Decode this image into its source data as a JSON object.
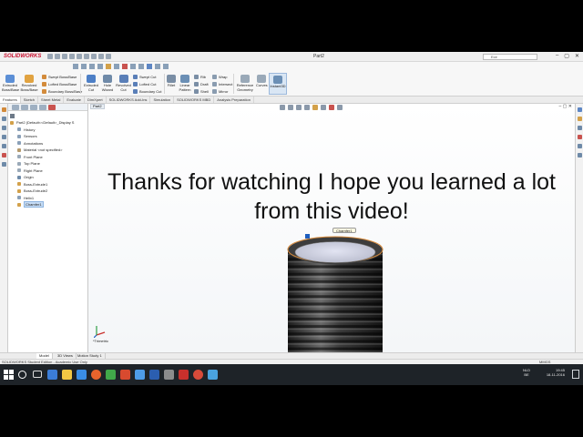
{
  "app": {
    "logo": "SOLIDWORKS",
    "document_title": "Part2",
    "search_placeholder": "Ece",
    "window_controls": [
      "–",
      "▢",
      "✕"
    ]
  },
  "ribbon": {
    "large_buttons": [
      {
        "label": "Extruded Boss/Base",
        "icon": "extruded-boss-icon"
      },
      {
        "label": "Revolved Boss/Base",
        "icon": "revolved-boss-icon"
      },
      {
        "label": "Extruded Cut",
        "icon": "extruded-cut-icon"
      },
      {
        "label": "Hole Wizard",
        "icon": "hole-wizard-icon"
      },
      {
        "label": "Revolved Cut",
        "icon": "revolved-cut-icon"
      },
      {
        "label": "Fillet",
        "icon": "fillet-icon"
      },
      {
        "label": "Linear Pattern",
        "icon": "linear-pattern-icon"
      },
      {
        "label": "Reference Geometry",
        "icon": "reference-geometry-icon"
      },
      {
        "label": "Curves",
        "icon": "curves-icon"
      },
      {
        "label": "Instant3D",
        "icon": "instant3d-icon"
      }
    ],
    "small_buttons": [
      "Swept Boss/Base",
      "Lofted Boss/Base",
      "Boundary Boss/Base",
      "Swept Cut",
      "Lofted Cut",
      "Boundary Cut",
      "Rib",
      "Draft",
      "Shell",
      "Wrap",
      "Intersect",
      "Mirror"
    ]
  },
  "command_tabs": [
    "Features",
    "Sketch",
    "Sheet Metal",
    "Evaluate",
    "DimXpert",
    "SOLIDWORKS Add-Ins",
    "Simulation",
    "SOLIDWORKS MBD",
    "Analysis Preparation"
  ],
  "feature_tree": {
    "root": "Part2 (Default<<Default>_Display S",
    "items": [
      "History",
      "Sensors",
      "Annotations",
      "Material <not specified>",
      "Front Plane",
      "Top Plane",
      "Right Plane",
      "Origin",
      "Boss-Extrude1",
      "Boss-Extrude2",
      "Helix1",
      "Chamfer1"
    ]
  },
  "viewport": {
    "tab_label": "Part2",
    "caption_line1": "Thanks for watching I hope you learned a lot",
    "caption_line2": "from this video!",
    "callout_label": "Chamfer1",
    "view_label": "*Trimetric"
  },
  "bottom_tabs": [
    "Model",
    "3D Views",
    "Motion Study 1"
  ],
  "status": {
    "left": "SOLIDWORKS Student Edition - Academic Use Only",
    "right": "MMGS"
  },
  "taskbar": {
    "search_placeholder": "",
    "language": "NLD",
    "language_sub": "BE",
    "time": "19:45",
    "date": "18-11-2016"
  },
  "colors": {
    "accent": "#c8102e",
    "selection": "#c6dcf5",
    "taskbar": "#1e2328",
    "cylinder_dark": "#2a2a2a",
    "edge_orange": "#d88a3a"
  }
}
